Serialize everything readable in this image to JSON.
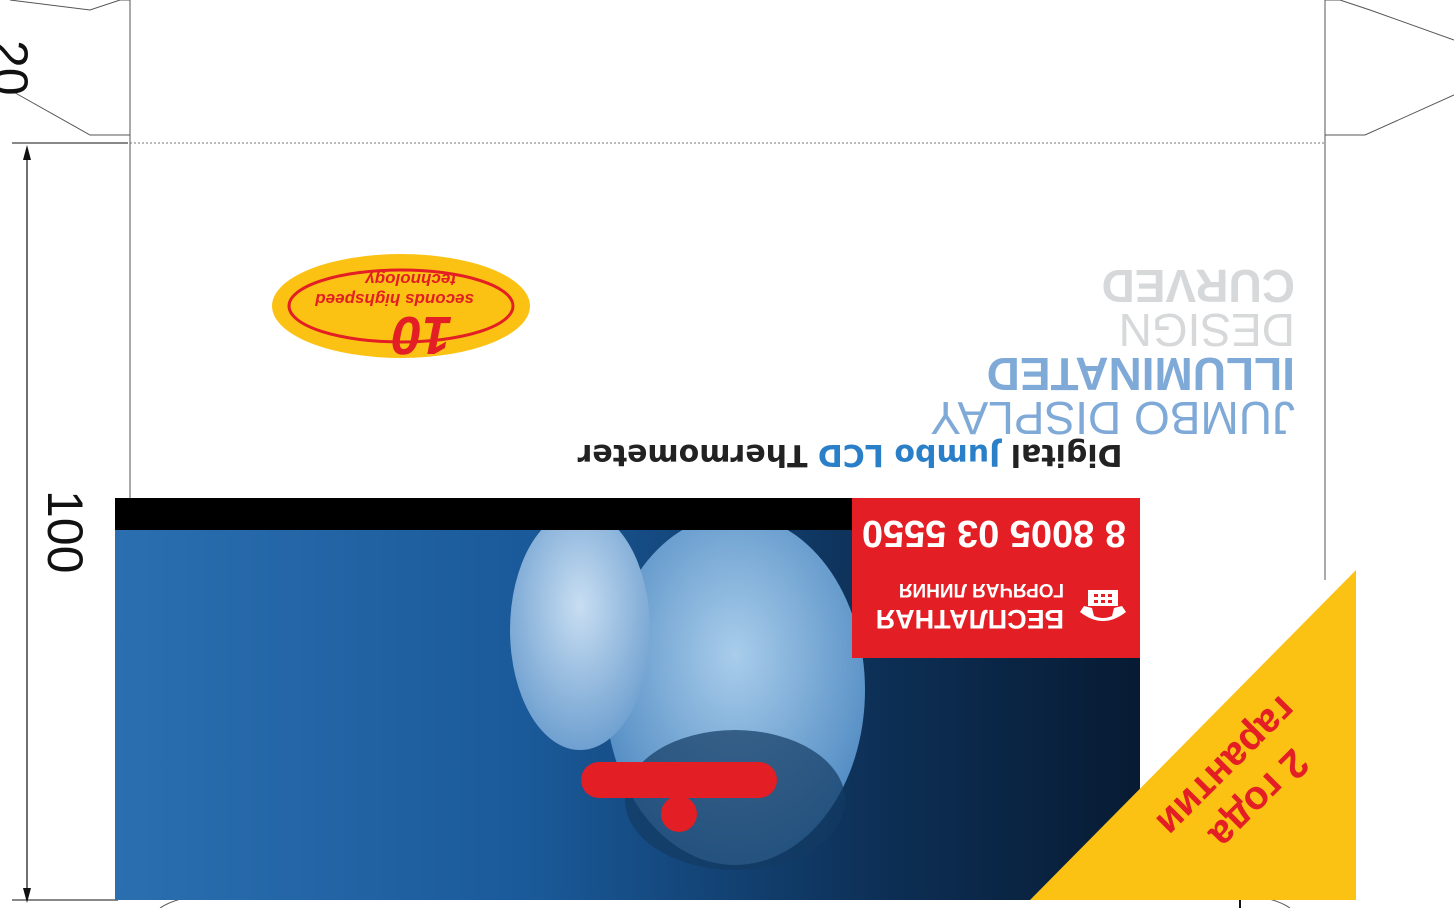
{
  "dimensions": {
    "height_label": "100",
    "tab_label": "20"
  },
  "tagline": {
    "part1": "Digital ",
    "part2": "Jumbo LCD",
    "part3": " Thermometer"
  },
  "features": {
    "line1": "CURVED",
    "line2": "DESIGN",
    "line3": "ILLUMINATED",
    "line4": "JUMBO DISPLAY"
  },
  "logo": {
    "number": "10",
    "line1": "seconds highspeed",
    "line2": "technology"
  },
  "hotline": {
    "phone": "8 8005 03 5550",
    "line1": "БЕСПЛАТНАЯ",
    "line2": "ГОРЯЧАЯ ЛИНИЯ",
    "icon": "phone-icon"
  },
  "warranty": {
    "line1": "2 года",
    "line2": "гарантии"
  },
  "colors": {
    "red": "#e31e24",
    "yellow": "#fbc214",
    "blue": "#2a7fc9",
    "light_blue": "#7fa9d6",
    "gray": "#d6d8da"
  }
}
